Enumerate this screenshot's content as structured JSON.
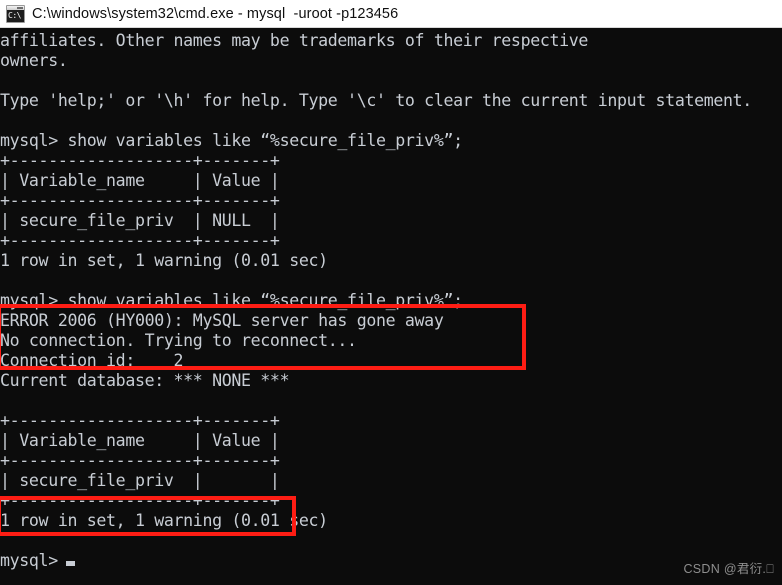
{
  "window": {
    "title": "C:\\windows\\system32\\cmd.exe - mysql  -uroot -p123456",
    "icon_name": "cmd-console-icon",
    "icon_glyph": "C:\\",
    "titlebar_background": "#ffffff",
    "titlebar_text_color": "#101010"
  },
  "console": {
    "background": "#0c0c0c",
    "foreground": "#c8cdd4",
    "lines": [
      "affiliates. Other names may be trademarks of their respective",
      "owners.",
      "",
      "Type 'help;' or '\\h' for help. Type '\\c' to clear the current input statement.",
      "",
      "mysql> show variables like “%secure_file_priv%”;",
      "+-------------------+-------+",
      "| Variable_name     | Value |",
      "+-------------------+-------+",
      "| secure_file_priv  | NULL  |",
      "+-------------------+-------+",
      "1 row in set, 1 warning (0.01 sec)",
      "",
      "mysql> show variables like “%secure_file_priv%”;",
      "ERROR 2006 (HY000): MySQL server has gone away",
      "No connection. Trying to reconnect...",
      "Connection id:    2",
      "Current database: *** NONE ***",
      "",
      "+-------------------+-------+",
      "| Variable_name     | Value |",
      "+-------------------+-------+",
      "| secure_file_priv  |       |",
      "+-------------------+-------+",
      "1 row in set, 1 warning (0.01 sec)",
      "",
      "mysql>"
    ],
    "prompt": "mysql>",
    "cursor": "block"
  },
  "annotations": {
    "color": "#fe1d14",
    "boxes": [
      {
        "name": "error-2006-highlight",
        "target_lines": [
          "mysql> show variables like “%secure_file_priv%”;",
          "ERROR 2006 (HY000): MySQL server has gone away"
        ]
      },
      {
        "name": "empty-value-highlight",
        "target_lines": [
          "| secure_file_priv  |       |"
        ]
      }
    ]
  },
  "watermark": {
    "text": "CSDN @君衍.⎕"
  }
}
